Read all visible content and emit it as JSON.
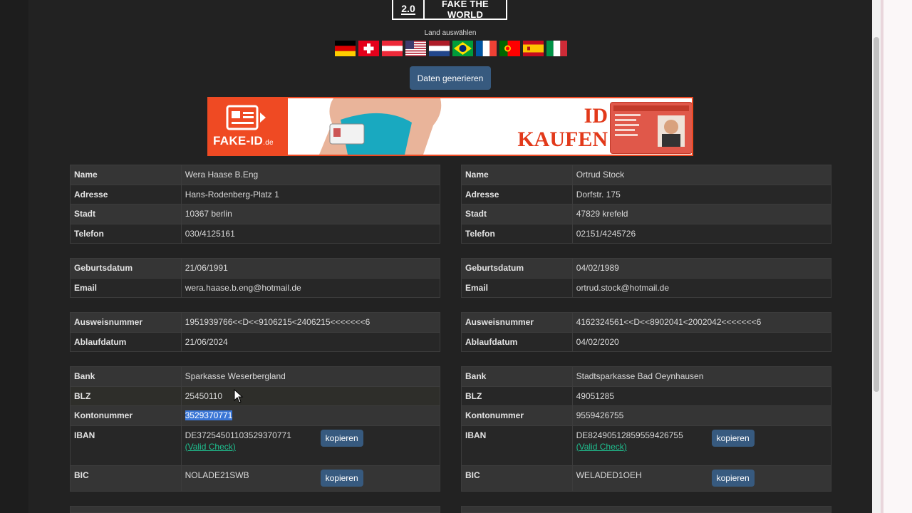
{
  "logo": {
    "version": "2.0",
    "name": "FAKE THE WORLD"
  },
  "country_label": "Land auswählen",
  "flags": [
    "germany-flag",
    "switzerland-flag",
    "austria-flag",
    "usa-flag",
    "netherlands-flag",
    "brazil-flag",
    "france-flag",
    "portugal-flag",
    "spain-flag",
    "italy-flag"
  ],
  "generate_button": "Daten generieren",
  "banner": {
    "brand": "FAKE-ID",
    "brand_suffix": ".de",
    "line1": "ID",
    "line2": "KAUFEN",
    "accent": "#ef4a23"
  },
  "left": {
    "personal": [
      {
        "label": "Name",
        "value": "Wera Haase B.Eng"
      },
      {
        "label": "Adresse",
        "value": "Hans-Rodenberg-Platz 1"
      },
      {
        "label": "Stadt",
        "value": "10367 berlin"
      },
      {
        "label": "Telefon",
        "value": "030/4125161"
      }
    ],
    "contact": [
      {
        "label": "Geburtsdatum",
        "value": "21/06/1991"
      },
      {
        "label": "Email",
        "value": "wera.haase.b.eng@hotmail.de"
      }
    ],
    "id": [
      {
        "label": "Ausweisnummer",
        "value": "1951939766<<D<<9106215<2406215<<<<<<<6"
      },
      {
        "label": "Ablaufdatum",
        "value": "21/06/2024"
      }
    ],
    "bank": {
      "bank_label": "Bank",
      "bank_value": "Sparkasse Weserbergland",
      "blz_label": "BLZ",
      "blz_value": "25450110",
      "konto_label": "Kontonummer",
      "konto_value": "3529370771",
      "iban_label": "IBAN",
      "iban_value": "DE37254501103529370771",
      "valid_check": "(Valid Check)",
      "bic_label": "BIC",
      "bic_value": "NOLADE21SWB",
      "copy_label": "kopieren"
    }
  },
  "right": {
    "personal": [
      {
        "label": "Name",
        "value": "Ortrud Stock"
      },
      {
        "label": "Adresse",
        "value": "Dorfstr. 175"
      },
      {
        "label": "Stadt",
        "value": "47829 krefeld"
      },
      {
        "label": "Telefon",
        "value": "02151/4245726"
      }
    ],
    "contact": [
      {
        "label": "Geburtsdatum",
        "value": "04/02/1989"
      },
      {
        "label": "Email",
        "value": "ortrud.stock@hotmail.de"
      }
    ],
    "id": [
      {
        "label": "Ausweisnummer",
        "value": "4162324561<<D<<8902041<2002042<<<<<<<6"
      },
      {
        "label": "Ablaufdatum",
        "value": "04/02/2020"
      }
    ],
    "bank": {
      "bank_label": "Bank",
      "bank_value": "Stadtsparkasse Bad Oeynhausen",
      "blz_label": "BLZ",
      "blz_value": "49051285",
      "konto_label": "Kontonummer",
      "konto_value": "9559426755",
      "iban_label": "IBAN",
      "iban_value": "DE82490512859559426755",
      "valid_check": "(Valid Check)",
      "bic_label": "BIC",
      "bic_value": "WELADED1OEH",
      "copy_label": "kopieren"
    }
  },
  "colors": {
    "button": "#375a7f",
    "background": "#222222",
    "valid_link": "#1fbf8f",
    "selection": "#3a76d6"
  }
}
